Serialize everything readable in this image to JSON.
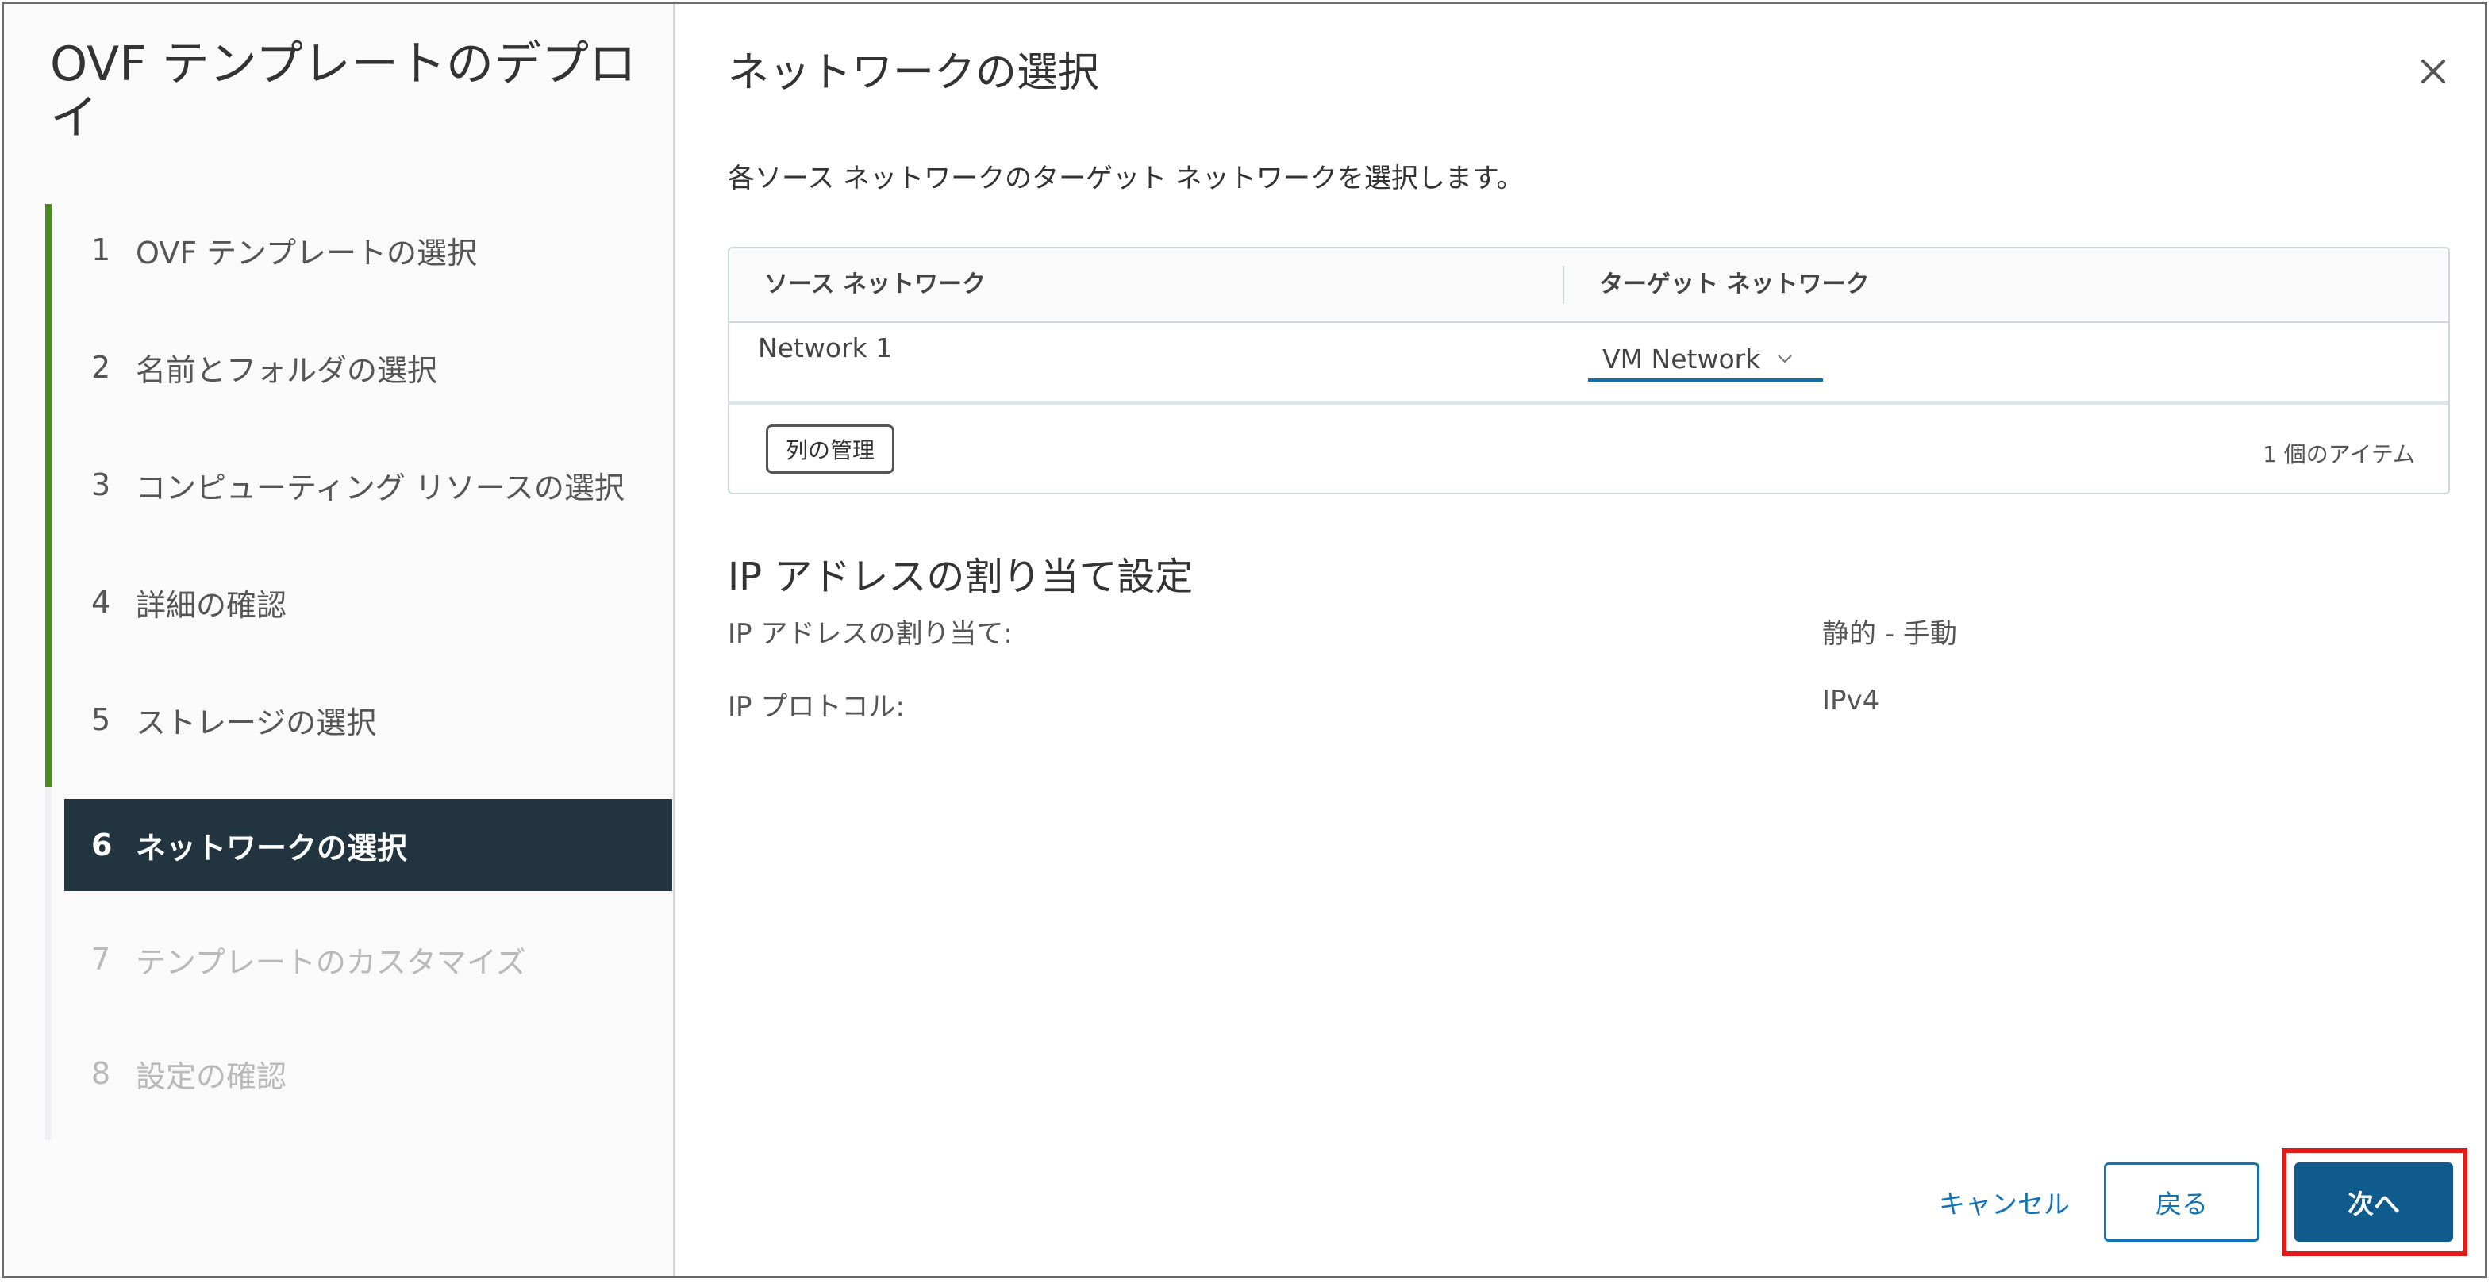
{
  "wizard": {
    "title": "OVF テンプレートのデプロイ",
    "steps": [
      {
        "num": "1",
        "label": "OVF テンプレートの選択",
        "state": "done"
      },
      {
        "num": "2",
        "label": "名前とフォルダの選択",
        "state": "done"
      },
      {
        "num": "3",
        "label": "コンピューティング リソースの選択",
        "state": "done"
      },
      {
        "num": "4",
        "label": "詳細の確認",
        "state": "done"
      },
      {
        "num": "5",
        "label": "ストレージの選択",
        "state": "done"
      },
      {
        "num": "6",
        "label": "ネットワークの選択",
        "state": "current"
      },
      {
        "num": "7",
        "label": "テンプレートのカスタマイズ",
        "state": "disabled"
      },
      {
        "num": "8",
        "label": "設定の確認",
        "state": "disabled"
      }
    ]
  },
  "page": {
    "title": "ネットワークの選択",
    "description": "各ソース ネットワークのターゲット ネットワークを選択します。"
  },
  "network_table": {
    "columns": [
      "ソース ネットワーク",
      "ターゲット ネットワーク"
    ],
    "rows": [
      {
        "source": "Network 1",
        "target": "VM Network"
      }
    ],
    "manage_columns_label": "列の管理",
    "item_count": "1 個のアイテム"
  },
  "ip_settings": {
    "title": "IP アドレスの割り当て設定",
    "allocation_label": "IP アドレスの割り当て:",
    "allocation_value": "静的 - 手動",
    "protocol_label": "IP プロトコル:",
    "protocol_value": "IPv4"
  },
  "footer": {
    "cancel_label": "キャンセル",
    "back_label": "戻る",
    "next_label": "次へ"
  },
  "colors": {
    "progress": "#4c8c1f",
    "current_step_bg": "#22343f",
    "primary": "#0f5b8c",
    "link": "#1374b5",
    "highlight": "#e11a1a"
  },
  "icons": {
    "close": "close-icon",
    "dropdown": "chevron-down-icon"
  }
}
